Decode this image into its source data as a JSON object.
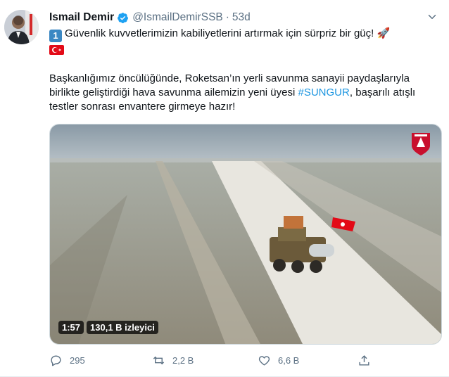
{
  "tweet": {
    "name": "Ismail Demir",
    "handle": "@IsmailDemirSSB",
    "dot": "·",
    "time": "53d",
    "line1_badge": "1",
    "line1": "Güvenlik kuvvetlerimizin kabiliyetlerini artırmak için sürpriz bir güç! 🚀",
    "line2": "Başkanlığımız öncülüğünde, Roketsan’ın yerli savunma sanayii paydaşlarıyla",
    "line3_pre": "birlikte geliştirdiği hava savunma ailemizin yeni üyesi ",
    "hashtag": "#SUNGUR",
    "line3_post": ", başarılı atışlı",
    "line4": "testler sonrası envantere girmeye hazır!"
  },
  "media": {
    "duration": "1:57",
    "views": "130,1 B izleyici"
  },
  "actions": {
    "replies": "295",
    "retweets": "2,2 B",
    "likes": "6,6 B"
  },
  "icons": {
    "verified": "verified-badge-icon",
    "reply": "reply-icon",
    "retweet": "retweet-icon",
    "like": "heart-icon",
    "share": "share-icon",
    "more": "chevron-down-icon"
  },
  "colors": {
    "accent": "#1b95e0",
    "secondary_text": "#5b7083",
    "verified": "#1da1f2"
  }
}
